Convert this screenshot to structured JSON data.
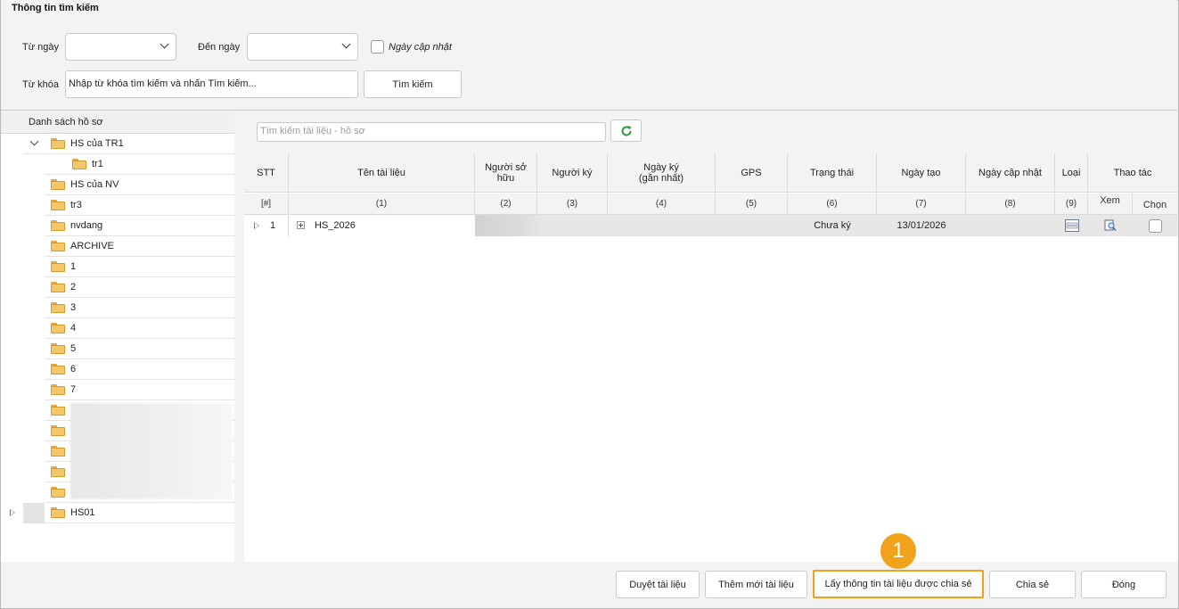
{
  "search": {
    "title": "Thông tin tìm kiếm",
    "from_date_label": "Từ ngày",
    "to_date_label": "Đến ngày",
    "updated_date_label": "Ngày cập nhật",
    "keyword_label": "Từ khóa",
    "keyword_value": "Nhập từ khóa tìm kiếm và nhấn Tìm kiếm...",
    "search_button": "Tìm kiếm"
  },
  "tree": {
    "header": "Danh sách hồ sơ",
    "items": [
      {
        "label": "HS của TR1"
      },
      {
        "label": "tr1"
      },
      {
        "label": "HS của NV"
      },
      {
        "label": "tr3"
      },
      {
        "label": "nvdang"
      },
      {
        "label": "ARCHIVE"
      },
      {
        "label": "1"
      },
      {
        "label": "2"
      },
      {
        "label": "3"
      },
      {
        "label": "4"
      },
      {
        "label": "5"
      },
      {
        "label": "6"
      },
      {
        "label": "7"
      },
      {
        "label": "HS01"
      }
    ]
  },
  "docs": {
    "search_placeholder": "Tìm kiếm tài liệu - hồ sơ",
    "columns": [
      {
        "label": "STT",
        "num": "[#]"
      },
      {
        "label": "Tên tài liệu",
        "num": "(1)"
      },
      {
        "label": "Người sở hữu",
        "num": "(2)"
      },
      {
        "label": "Người ký",
        "num": "(3)"
      },
      {
        "label": "Ngày ký (gần nhất)",
        "num": "(4)"
      },
      {
        "label": "GPS",
        "num": "(5)"
      },
      {
        "label": "Trạng thái",
        "num": "(6)"
      },
      {
        "label": "Ngày tạo",
        "num": "(7)"
      },
      {
        "label": "Ngày cập nhật",
        "num": "(8)"
      },
      {
        "label": "Loại",
        "num": "(9)"
      }
    ],
    "actions_header": "Thao tác",
    "view_header": "Xem",
    "select_header": "Chọn",
    "rows": [
      {
        "stt": "1",
        "name": "HS_2026",
        "status": "Chưa ký",
        "created": "13/01/2026"
      }
    ]
  },
  "footer": {
    "browse": "Duyệt tài liệu",
    "add": "Thêm mới tài liệu",
    "get_shared": "Lấy thông tin tài liệu được chia sẻ",
    "share": "Chia sẻ",
    "close": "Đóng"
  },
  "callout": "1",
  "colors": {
    "accent": "#f0a21b",
    "refresh": "#2e9a3e",
    "folder": "#f5c76b"
  }
}
